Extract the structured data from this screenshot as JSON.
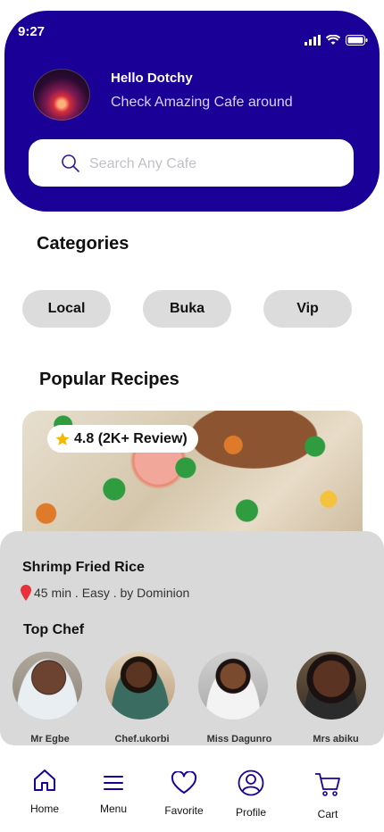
{
  "status": {
    "time": "9:27"
  },
  "header": {
    "greeting": "Hello Dotchy",
    "subtitle": "Check Amazing Cafe around"
  },
  "search": {
    "placeholder": "Search Any Cafe"
  },
  "categories": {
    "title": "Categories",
    "items": [
      "Local",
      "Buka",
      "Vip"
    ]
  },
  "popular": {
    "title": "Popular Recipes",
    "rating": "4.8 (2K+ Review)",
    "recipe_name": "Shrimp Fried Rice",
    "recipe_meta": "45 min . Easy . by Dominion"
  },
  "top_chef": {
    "title": "Top Chef",
    "chefs": [
      "Mr Egbe",
      "Chef.ukorbi",
      "Miss Dagunro",
      "Mrs abiku"
    ]
  },
  "nav": {
    "items": [
      "Home",
      "Menu",
      "Favorite",
      "Profile",
      "Cart"
    ]
  },
  "colors": {
    "primary": "#1a0096",
    "chip": "#dcdcdc",
    "sheet": "#d9d9d9"
  }
}
